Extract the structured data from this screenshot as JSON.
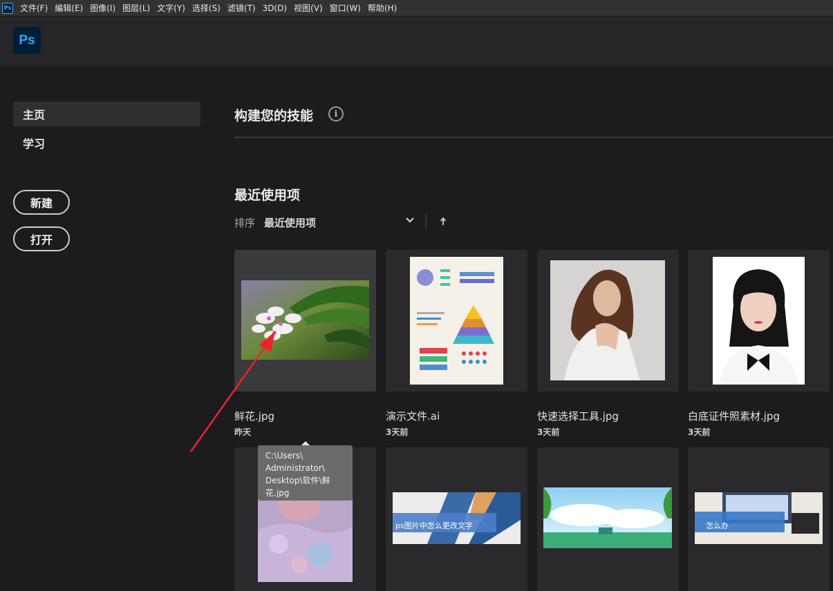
{
  "menu": {
    "app_icon": "Ps",
    "items": [
      "文件(F)",
      "编辑(E)",
      "图像(I)",
      "图层(L)",
      "文字(Y)",
      "选择(S)",
      "滤镜(T)",
      "3D(D)",
      "视图(V)",
      "窗口(W)",
      "帮助(H)"
    ]
  },
  "header": {
    "logo": "Ps"
  },
  "sidebar": {
    "items": [
      {
        "label": "主页",
        "active": true
      },
      {
        "label": "学习",
        "active": false
      }
    ],
    "new_button": "新建",
    "open_button": "打开"
  },
  "main": {
    "skills_title": "构建您的技能",
    "info_icon": "i",
    "recent_title": "最近使用项",
    "sort_label": "排序",
    "sort_value": "最近使用项"
  },
  "recent_files": [
    {
      "name": "鲜花.jpg",
      "date": "昨天"
    },
    {
      "name": "演示文件.ai",
      "date": "3天前"
    },
    {
      "name": "快速选择工具.jpg",
      "date": "3天前"
    },
    {
      "name": "白底证件照素材.jpg",
      "date": "3天前"
    }
  ],
  "second_row": [
    {
      "banner_text": ""
    },
    {
      "banner_text": "ps图片中怎么更改文字"
    },
    {
      "banner_text": ""
    },
    {
      "banner_text": "怎么办"
    }
  ],
  "tooltip": {
    "lines": [
      "C:\\Users\\",
      "Administrator\\",
      "Desktop\\软件\\鲜",
      "花.jpg"
    ]
  },
  "colors": {
    "background": "#1c1b1e",
    "ps_blue": "#31a8ff",
    "annotation_red": "#e8262a"
  }
}
